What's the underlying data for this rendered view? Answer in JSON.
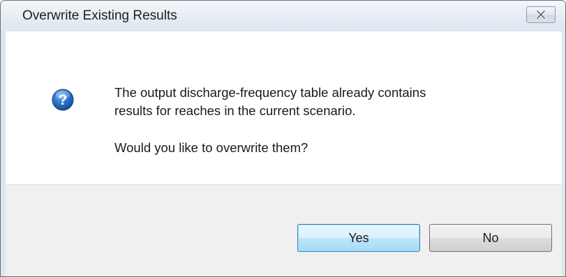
{
  "window": {
    "title": "Overwrite Existing Results",
    "close_icon": "close-icon"
  },
  "message": {
    "icon": "question-icon",
    "line1": "The output discharge-frequency table already contains",
    "line2": "results for reaches in the current scenario.",
    "question": "Would you like to overwrite them?"
  },
  "buttons": {
    "yes_label": "Yes",
    "no_label": "No",
    "default": "Yes"
  },
  "colors": {
    "accent_default_button": "#3c7fb1",
    "icon_blue": "#1f5fa8",
    "footer_background": "#f0f0f0"
  }
}
